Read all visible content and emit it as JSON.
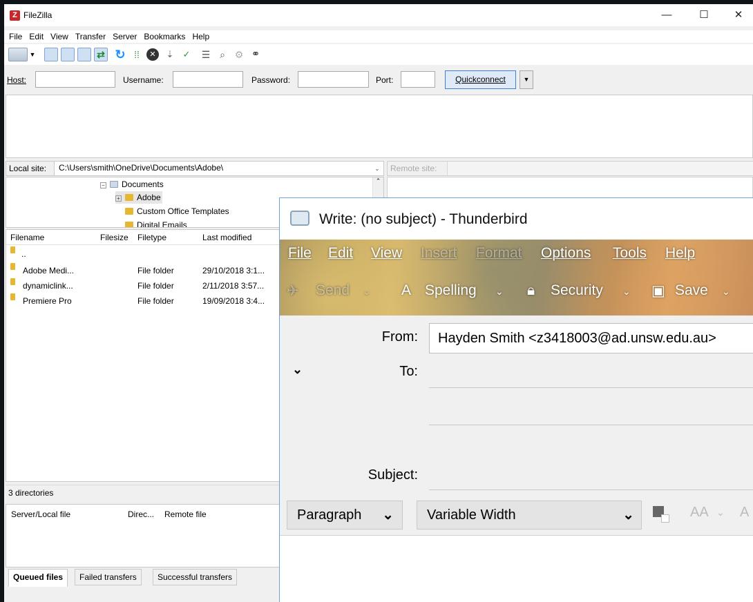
{
  "filezilla": {
    "title": "FileZilla",
    "window_controls": {
      "minimize": "—",
      "maximize": "☐",
      "close": "✕"
    },
    "menu": [
      "File",
      "Edit",
      "View",
      "Transfer",
      "Server",
      "Bookmarks",
      "Help"
    ],
    "quickconnect": {
      "host_label": "Host:",
      "host_value": "",
      "username_label": "Username:",
      "username_value": "",
      "password_label": "Password:",
      "password_value": "",
      "port_label": "Port:",
      "port_value": "",
      "button_label": "Quickconnect"
    },
    "local_site": {
      "label": "Local site:",
      "path": "C:\\Users\\smith\\OneDrive\\Documents\\Adobe\\"
    },
    "remote_site": {
      "label": "Remote site:",
      "path": ""
    },
    "tree": {
      "documents": "Documents",
      "adobe": "Adobe",
      "custom_office": "Custom Office Templates",
      "partial": "Digital Emails"
    },
    "file_list": {
      "columns": [
        "Filename",
        "Filesize",
        "Filetype",
        "Last modified"
      ],
      "parent": "..",
      "rows": [
        {
          "name": "Adobe Medi...",
          "size": "",
          "type": "File folder",
          "modified": "29/10/2018 3:1..."
        },
        {
          "name": "dynamiclink...",
          "size": "",
          "type": "File folder",
          "modified": "2/11/2018 3:57..."
        },
        {
          "name": "Premiere Pro",
          "size": "",
          "type": "File folder",
          "modified": "19/09/2018 3:4..."
        }
      ]
    },
    "local_status": "3 directories",
    "queue_columns": [
      "Server/Local file",
      "Direc...",
      "Remote file"
    ],
    "queue_tabs": [
      "Queued files",
      "Failed transfers",
      "Successful transfers"
    ]
  },
  "thunderbird": {
    "title": "Write: (no subject) - Thunderbird",
    "menu": [
      "File",
      "Edit",
      "View",
      "Insert",
      "Format",
      "Options",
      "Tools",
      "Help"
    ],
    "toolbar": {
      "send": "Send",
      "spelling": "Spelling",
      "security": "Security",
      "save": "Save"
    },
    "from_label": "From:",
    "from_value": "Hayden Smith <z3418003@ad.unsw.edu.au>",
    "to_label": "To:",
    "subject_label": "Subject:",
    "paragraph_select": "Paragraph",
    "font_select": "Variable Width"
  }
}
